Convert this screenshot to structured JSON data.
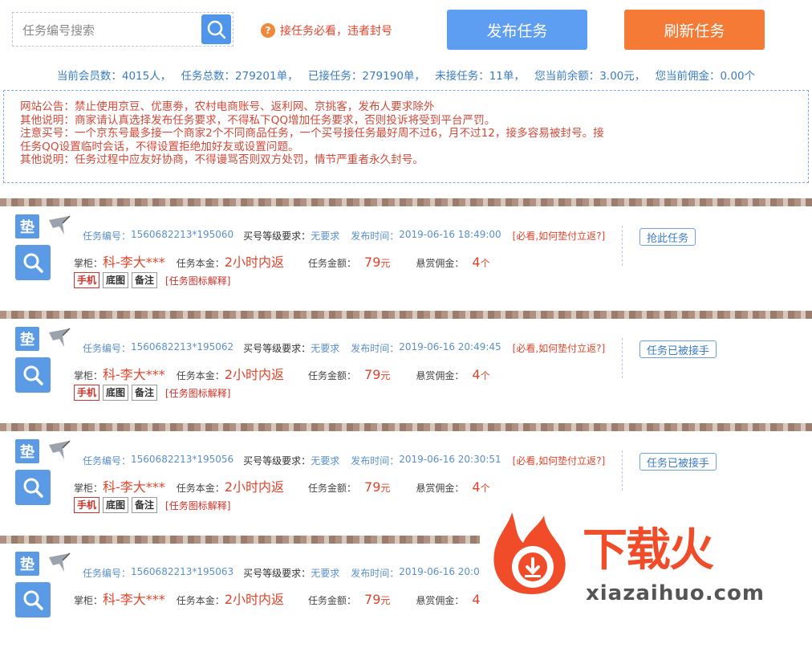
{
  "header": {
    "search_placeholder": "任务编号搜索",
    "warning": "接任务必看，违者封号",
    "warning_icon": "?",
    "publish_label": "发布任务",
    "refresh_label": "刷新任务",
    "colors": {
      "publish": "#5d9ef3",
      "refresh": "#f57a35",
      "accent_blue": "#3a7cc4",
      "alert_red": "#e0442a"
    }
  },
  "stats": {
    "members": "当前会员数：4015人，",
    "total": "任务总数：279201单，",
    "taken": "已接任务：279190单，",
    "open": "未接任务：11单，",
    "balance": "您当前余额：3.00元，",
    "commission": "您当前佣金：0.00个"
  },
  "notice": {
    "lines": [
      "网站公告：禁止使用京豆、优惠劵，农村电商账号、返利网、京挑客，发布人要求除外",
      "其他说明：商家请认真选择发布任务要求，不得私下QQ增加任务要求，否则投诉将受到平台严罚。",
      "注意买号：一个京东号最多接一个商家2个不同商品任务，一个买号接任务最好周不过6，月不过12，接多容易被封号。接",
      "任务QQ设置临时会话，不得设置拒绝加好友或设置问题。",
      "其他说明：任务过程中应友好协商，不得谩骂否则双方处罚，情节严重者永久封号。"
    ]
  },
  "labels": {
    "dian": "垫",
    "task_no": "任务编号：",
    "level_req": "买号等级要求：",
    "publish_time": "发布时间：",
    "must_see": "[必看,如何垫付立返?]",
    "shopkeeper": "掌柜：",
    "principal": "任务本金：",
    "amount": "任务金额：",
    "reward": "悬赏佣金：",
    "tag_phone": "手机",
    "tag_bg": "底图",
    "tag_note": "备注",
    "icon_explain": "[任务图标解释]"
  },
  "tasks": [
    {
      "id": "1560682213*195060",
      "level": "无要求",
      "time": "2019-06-16 18:49:00",
      "shop": "科-李大***",
      "principal": "2小时内返",
      "amount": "79",
      "amount_unit": "元",
      "reward": "4",
      "reward_unit": "个",
      "action": "抢此任务"
    },
    {
      "id": "1560682213*195062",
      "level": "无要求",
      "time": "2019-06-16 20:49:45",
      "shop": "科-李大***",
      "principal": "2小时内返",
      "amount": "79",
      "amount_unit": "元",
      "reward": "4",
      "reward_unit": "个",
      "action": "任务已被接手"
    },
    {
      "id": "1560682213*195056",
      "level": "无要求",
      "time": "2019-06-16 20:30:51",
      "shop": "科-李大***",
      "principal": "2小时内返",
      "amount": "79",
      "amount_unit": "元",
      "reward": "4",
      "reward_unit": "个",
      "action": "任务已被接手"
    },
    {
      "id": "1560682213*195063",
      "level": "无要求",
      "time": "2019-06-16 20:05",
      "shop": "科-李大***",
      "principal": "2小时内返",
      "amount": "79",
      "amount_unit": "元",
      "reward": "4",
      "reward_unit": "个",
      "action": ""
    }
  ],
  "watermark": {
    "brand": "下载火",
    "url": "xiazaihuo.com",
    "color": "#f04c2a"
  }
}
